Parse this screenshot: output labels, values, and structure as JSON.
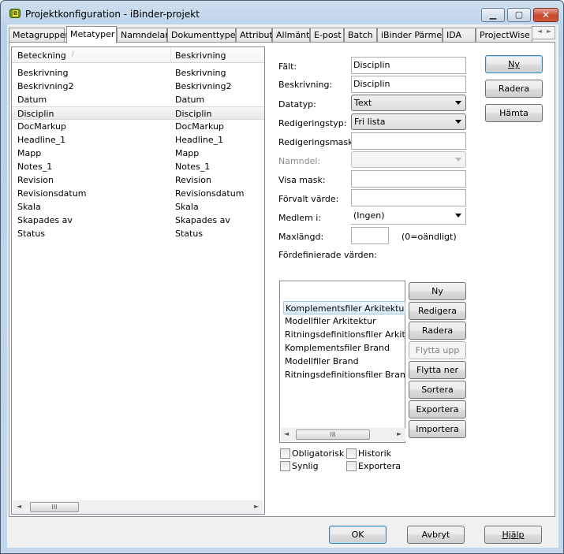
{
  "window": {
    "title": "Projektkonfiguration - iBinder-projekt",
    "minimize_glyph": "▁",
    "maximize_glyph": "▢",
    "close_glyph": "✕"
  },
  "tabs": [
    {
      "label": "Metagrupper",
      "active": false
    },
    {
      "label": "Metatyper",
      "active": true
    },
    {
      "label": "Namndelar",
      "active": false
    },
    {
      "label": "Dokumenttyper",
      "active": false
    },
    {
      "label": "Attribut",
      "active": false
    },
    {
      "label": "Allmänt",
      "active": false
    },
    {
      "label": "E-post",
      "active": false
    },
    {
      "label": "Batch",
      "active": false
    },
    {
      "label": "iBinder Pärmen",
      "active": false
    },
    {
      "label": "IDA",
      "active": false
    },
    {
      "label": "ProjectWise",
      "active": false
    }
  ],
  "list": {
    "columns": [
      "Beteckning",
      "Beskrivning"
    ],
    "sort_indicator": "/",
    "rows": [
      {
        "name": "Beskrivning",
        "desc": "Beskrivning"
      },
      {
        "name": "Beskrivning2",
        "desc": "Beskrivning2"
      },
      {
        "name": "Datum",
        "desc": "Datum"
      },
      {
        "name": "Disciplin",
        "desc": "Disciplin",
        "selected": true
      },
      {
        "name": "DocMarkup",
        "desc": "DocMarkup"
      },
      {
        "name": "Headline_1",
        "desc": "Headline_1"
      },
      {
        "name": "Mapp",
        "desc": "Mapp"
      },
      {
        "name": "Notes_1",
        "desc": "Notes_1"
      },
      {
        "name": "Revision",
        "desc": "Revision"
      },
      {
        "name": "Revisionsdatum",
        "desc": "Revisionsdatum"
      },
      {
        "name": "Skala",
        "desc": "Skala"
      },
      {
        "name": "Skapades av",
        "desc": "Skapades av"
      },
      {
        "name": "Status",
        "desc": "Status"
      }
    ]
  },
  "form": {
    "falt_label": "Fält:",
    "falt_value": "Disciplin",
    "beskrivning_label": "Beskrivning:",
    "beskrivning_value": "Disciplin",
    "datatyp_label": "Datatyp:",
    "datatyp_value": "Text",
    "redigeringstyp_label": "Redigeringstyp:",
    "redigeringstyp_value": "Fri lista",
    "redigeringsmask_label": "Redigeringsmask:",
    "redigeringsmask_value": "",
    "namndel_label": "Namndel:",
    "namndel_value": "",
    "visa_mask_label": "Visa mask:",
    "visa_mask_value": "",
    "forvalt_label": "Förvalt värde:",
    "forvalt_value": "",
    "medlem_label": "Medlem i:",
    "medlem_value": "(Ingen)",
    "maxlangd_label": "Maxlängd:",
    "maxlangd_value": "",
    "maxlangd_hint": "(0=oändligt)",
    "predef_label": "Fördefinierade värden:"
  },
  "side_buttons": {
    "ny": "Ny",
    "radera": "Radera",
    "hamta": "Hämta"
  },
  "predef": {
    "items": [
      {
        "label": "Komplementsfiler Arkitektur",
        "selected": true
      },
      {
        "label": "Modellfiler Arkitektur"
      },
      {
        "label": "Ritningsdefinitionsfiler Arkitektur"
      },
      {
        "label": "Komplementsfiler Brand"
      },
      {
        "label": "Modellfiler Brand"
      },
      {
        "label": "Ritningsdefinitionsfiler Brand"
      }
    ],
    "buttons": {
      "ny": "Ny",
      "redigera": "Redigera",
      "radera": "Radera",
      "flytta_upp": "Flytta upp",
      "flytta_ner": "Flytta ner",
      "sortera": "Sortera",
      "exportera": "Exportera",
      "importera": "Importera"
    }
  },
  "checkboxes": {
    "obligatorisk": {
      "label": "Obligatorisk",
      "checked": false
    },
    "historik": {
      "label": "Historik",
      "checked": false
    },
    "synlig": {
      "label": "Synlig",
      "checked": false
    },
    "exportera": {
      "label": "Exportera",
      "checked": false
    }
  },
  "footer": {
    "ok": "OK",
    "avbryt": "Avbryt",
    "hjalp": "Hjälp"
  },
  "scroll_glyphs": {
    "left": "◄",
    "right": "►",
    "grip": "III"
  }
}
